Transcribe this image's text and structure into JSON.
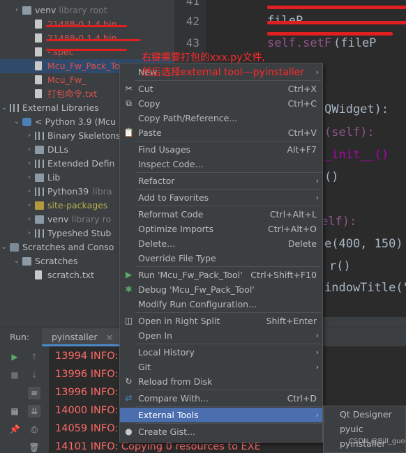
{
  "project_tree": {
    "items": [
      {
        "label": "venv",
        "suffix": "library root",
        "indent": 1,
        "arrow": "›",
        "icon": "folder",
        "style": "normal"
      },
      {
        "label": "21488-0.1.4.bin",
        "suffix": "",
        "indent": 2,
        "arrow": "",
        "icon": "file",
        "style": "red"
      },
      {
        "label": "21488-0.1.4.bin",
        "suffix": "",
        "indent": 2,
        "arrow": "",
        "icon": "file",
        "style": "red"
      },
      {
        "label": "-.spec",
        "suffix": "",
        "indent": 2,
        "arrow": "",
        "icon": "file",
        "style": "red"
      },
      {
        "label": "Mcu_Fw_Pack_Tool",
        "suffix": "",
        "indent": 2,
        "arrow": "",
        "icon": "file",
        "style": "red"
      },
      {
        "label": "Mcu_Fw_",
        "suffix": "",
        "indent": 2,
        "arrow": "",
        "icon": "file",
        "style": "red"
      },
      {
        "label": "打包命令.txt",
        "suffix": "",
        "indent": 2,
        "arrow": "",
        "icon": "file",
        "style": "red"
      },
      {
        "label": "External Libraries",
        "suffix": "",
        "indent": 0,
        "arrow": "⌄",
        "icon": "lib",
        "style": "normal"
      },
      {
        "label": "< Python 3.9 (Mcu",
        "suffix": "",
        "indent": 1,
        "arrow": "⌄",
        "icon": "py",
        "style": "normal"
      },
      {
        "label": "Binary Skeletons",
        "suffix": "",
        "indent": 2,
        "arrow": "›",
        "icon": "lib",
        "style": "normal"
      },
      {
        "label": "DLLs",
        "suffix": "",
        "indent": 2,
        "arrow": "›",
        "icon": "folder",
        "style": "normal"
      },
      {
        "label": "Extended Defin",
        "suffix": "",
        "indent": 2,
        "arrow": "›",
        "icon": "lib",
        "style": "normal"
      },
      {
        "label": "Lib",
        "suffix": "",
        "indent": 2,
        "arrow": "›",
        "icon": "folder",
        "style": "normal"
      },
      {
        "label": "Python39",
        "suffix": "libra",
        "indent": 2,
        "arrow": "›",
        "icon": "lib",
        "style": "normal"
      },
      {
        "label": "site-packages",
        "suffix": "",
        "indent": 2,
        "arrow": "›",
        "icon": "folder-yellow",
        "style": "yellow"
      },
      {
        "label": "venv",
        "suffix": "library ro",
        "indent": 2,
        "arrow": "›",
        "icon": "folder",
        "style": "normal"
      },
      {
        "label": "Typeshed Stub",
        "suffix": "",
        "indent": 2,
        "arrow": "›",
        "icon": "lib",
        "style": "normal"
      },
      {
        "label": "Scratches and Conso",
        "suffix": "",
        "indent": 0,
        "arrow": "⌄",
        "icon": "scratch",
        "style": "normal"
      },
      {
        "label": "Scratches",
        "suffix": "",
        "indent": 1,
        "arrow": "⌄",
        "icon": "folder",
        "style": "normal"
      },
      {
        "label": "scratch.txt",
        "suffix": "",
        "indent": 2,
        "arrow": "",
        "icon": "file",
        "style": "normal"
      }
    ]
  },
  "editor": {
    "line_numbers": [
      "41",
      "42",
      "43"
    ],
    "fragments": [
      {
        "text": "fileP",
        "class": "",
        "line": 1
      },
      {
        "text": "self.setF",
        "class": "kw-self",
        "line": 2
      },
      {
        "text": "(fileP",
        "class": "",
        "line": 2
      },
      {
        "text": "QWidget):",
        "class": "",
        "line": 4
      },
      {
        "text": "(self):",
        "class": "kw-self",
        "line": 5
      },
      {
        "text": "_init__()",
        "class": "kw-init",
        "line": 6
      },
      {
        "text": "()",
        "class": "",
        "line": 7
      },
      {
        "text": "elf):",
        "class": "kw-self",
        "line": 8
      },
      {
        "text": "e(400, 150)",
        "class": "",
        "line": 9
      },
      {
        "text": "r()",
        "class": "",
        "line": 10
      },
      {
        "text": "indowTitle(\"M",
        "class": "",
        "line": 11
      }
    ]
  },
  "annotation": {
    "line1": "右键需要打包的xxx.py文件,",
    "line2": "然后选择external tool---pyinstaller"
  },
  "context_menu": {
    "items": [
      {
        "label": "New",
        "shortcut": "",
        "submenu": true,
        "icon": "",
        "sep_after": true
      },
      {
        "label": "Cut",
        "shortcut": "Ctrl+X",
        "submenu": false,
        "icon": "✂",
        "sep_after": false
      },
      {
        "label": "Copy",
        "shortcut": "Ctrl+C",
        "submenu": false,
        "icon": "⧉",
        "sep_after": false
      },
      {
        "label": "Copy Path/Reference...",
        "shortcut": "",
        "submenu": false,
        "icon": "",
        "sep_after": false
      },
      {
        "label": "Paste",
        "shortcut": "Ctrl+V",
        "submenu": false,
        "icon": "📋",
        "sep_after": true
      },
      {
        "label": "Find Usages",
        "shortcut": "Alt+F7",
        "submenu": false,
        "icon": "",
        "sep_after": false
      },
      {
        "label": "Inspect Code...",
        "shortcut": "",
        "submenu": false,
        "icon": "",
        "sep_after": true
      },
      {
        "label": "Refactor",
        "shortcut": "",
        "submenu": true,
        "icon": "",
        "sep_after": true
      },
      {
        "label": "Add to Favorites",
        "shortcut": "",
        "submenu": true,
        "icon": "",
        "sep_after": true
      },
      {
        "label": "Reformat Code",
        "shortcut": "Ctrl+Alt+L",
        "submenu": false,
        "icon": "",
        "sep_after": false
      },
      {
        "label": "Optimize Imports",
        "shortcut": "Ctrl+Alt+O",
        "submenu": false,
        "icon": "",
        "sep_after": false
      },
      {
        "label": "Delete...",
        "shortcut": "Delete",
        "submenu": false,
        "icon": "",
        "sep_after": false
      },
      {
        "label": "Override File Type",
        "shortcut": "",
        "submenu": false,
        "icon": "",
        "sep_after": true
      },
      {
        "label": "Run 'Mcu_Fw_Pack_Tool'",
        "shortcut": "Ctrl+Shift+F10",
        "submenu": false,
        "icon": "▶",
        "sep_after": false
      },
      {
        "label": "Debug 'Mcu_Fw_Pack_Tool'",
        "shortcut": "",
        "submenu": false,
        "icon": "✱",
        "sep_after": false
      },
      {
        "label": "Modify Run Configuration...",
        "shortcut": "",
        "submenu": false,
        "icon": "",
        "sep_after": true
      },
      {
        "label": "Open in Right Split",
        "shortcut": "Shift+Enter",
        "submenu": false,
        "icon": "◫",
        "sep_after": false
      },
      {
        "label": "Open In",
        "shortcut": "",
        "submenu": true,
        "icon": "",
        "sep_after": true
      },
      {
        "label": "Local History",
        "shortcut": "",
        "submenu": true,
        "icon": "",
        "sep_after": false
      },
      {
        "label": "Git",
        "shortcut": "",
        "submenu": true,
        "icon": "",
        "sep_after": false
      },
      {
        "label": "Reload from Disk",
        "shortcut": "",
        "submenu": false,
        "icon": "↻",
        "sep_after": true
      },
      {
        "label": "Compare With...",
        "shortcut": "Ctrl+D",
        "submenu": false,
        "icon": "⇄",
        "sep_after": true
      },
      {
        "label": "External Tools",
        "shortcut": "",
        "submenu": true,
        "icon": "",
        "sep_after": true,
        "highlighted": true
      },
      {
        "label": "Create Gist...",
        "shortcut": "",
        "submenu": false,
        "icon": "●",
        "sep_after": false
      }
    ]
  },
  "submenu": {
    "items": [
      "Qt Designer",
      "pyuic",
      "pyinstaller"
    ]
  },
  "run_panel": {
    "label": "Run:",
    "tab_label": "pyinstaller",
    "tab_close": "×",
    "console_lines": [
      "13994 INFO:",
      "13996 INFO:",
      "13996 INFO:",
      "14000 INFO:",
      "14059 INFO:",
      "14101 INFO: Copying 0 resources to EXE"
    ]
  },
  "watermark": "CSDN @Bill_guo",
  "colors": {
    "menu_highlight": "#4b6eaf",
    "console_error": "#ff6b68",
    "annotation": "#ff2a2a",
    "tab_underline": "#4a88c7"
  }
}
